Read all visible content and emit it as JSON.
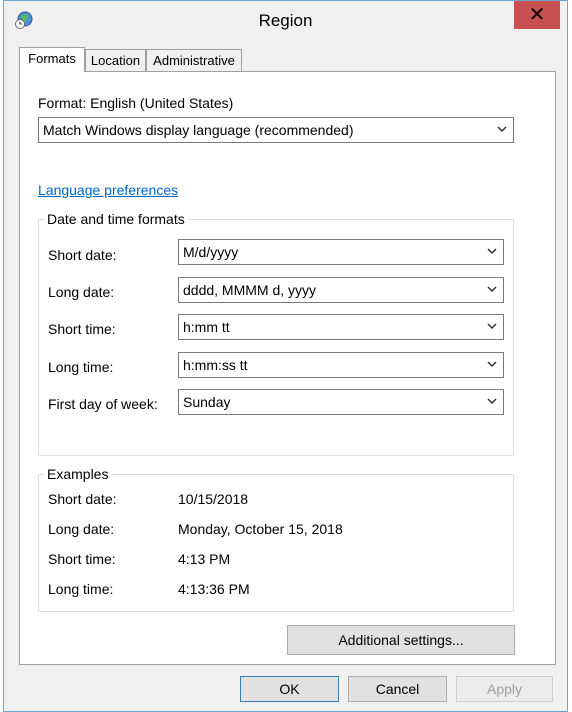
{
  "window": {
    "title": "Region"
  },
  "tabs": [
    {
      "label": "Formats",
      "active": true
    },
    {
      "label": "Location",
      "active": false
    },
    {
      "label": "Administrative",
      "active": false
    }
  ],
  "format": {
    "label": "Format: English (United States)",
    "selected": "Match Windows display language (recommended)"
  },
  "language_link": "Language preferences",
  "date_time_formats": {
    "title": "Date and time formats",
    "rows": [
      {
        "label": "Short date:",
        "value": "M/d/yyyy"
      },
      {
        "label": "Long date:",
        "value": "dddd, MMMM d, yyyy"
      },
      {
        "label": "Short time:",
        "value": "h:mm tt"
      },
      {
        "label": "Long time:",
        "value": "h:mm:ss tt"
      },
      {
        "label": "First day of week:",
        "value": "Sunday"
      }
    ]
  },
  "examples": {
    "title": "Examples",
    "rows": [
      {
        "label": "Short date:",
        "value": "10/15/2018"
      },
      {
        "label": "Long date:",
        "value": "Monday, October 15, 2018"
      },
      {
        "label": "Short time:",
        "value": "4:13 PM"
      },
      {
        "label": "Long time:",
        "value": "4:13:36 PM"
      }
    ]
  },
  "buttons": {
    "additional_settings": "Additional settings...",
    "ok": "OK",
    "cancel": "Cancel",
    "apply": "Apply"
  },
  "colors": {
    "link": "#0066cc",
    "close": "#c75050",
    "border": "#6fa3d6"
  },
  "icons": {
    "app": "globe-clock-icon",
    "close": "close-icon",
    "dropdown": "chevron-down-icon"
  }
}
